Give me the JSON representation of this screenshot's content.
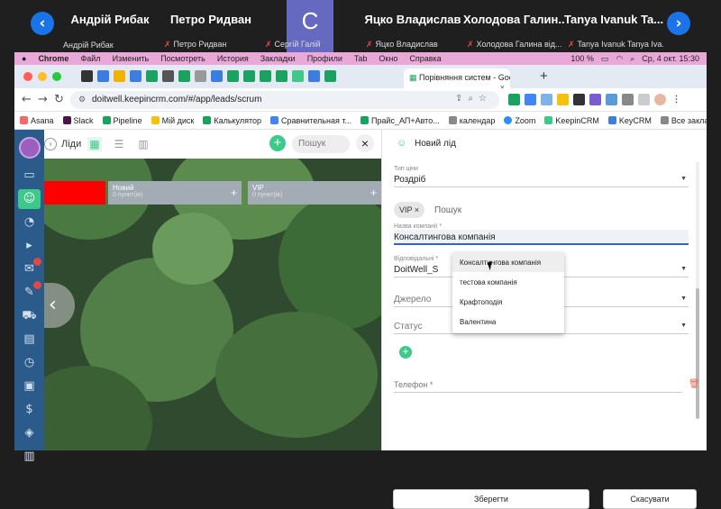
{
  "call": {
    "participants": [
      {
        "big": "Андрій Рибак",
        "small": "Андрій Рибак",
        "muted": false
      },
      {
        "big": "Петро Ридван",
        "small": "Петро Ридван",
        "muted": true
      },
      {
        "big": "C",
        "small": "Сергій Галій",
        "muted": true
      },
      {
        "big": "Яцко Владислав",
        "small": "Яцко Владислав",
        "muted": true
      },
      {
        "big": "Холодова Галин...",
        "small": "Холодова Галина  від...",
        "muted": true
      },
      {
        "big": "Tanya Ivanuk Ta...",
        "small": "Tanya Ivanuk Tanya Iva...",
        "muted": true
      }
    ],
    "prev_icon": "chevron-left-icon",
    "next_icon": "chevron-right-icon"
  },
  "menubar": {
    "items": [
      "Chrome",
      "Файл",
      "Изменить",
      "Посмотреть",
      "История",
      "Закладки",
      "Профили",
      "Tab",
      "Окно",
      "Справка"
    ],
    "battery": "100 %",
    "clock": "Ср, 4 окт.  15:30"
  },
  "browser": {
    "active_tab": "Порівняння систем - Google",
    "url": "doitwell.keepincrm.com/#/app/leads/scrum",
    "bookmarks": [
      "Asana",
      "Slack",
      "Pipeline",
      "Мій диск",
      "Калькулятор",
      "Сравнительная т...",
      "Прайс_АП+Авто...",
      "календар",
      "Zoom",
      "KeepinCRM",
      "KeyCRM"
    ],
    "all_bookmarks": "Все закладки"
  },
  "leads": {
    "title": "Ліди",
    "search_placeholder": "Пошук",
    "columns": [
      {
        "name": "",
        "count": "",
        "color": "#ff0000"
      },
      {
        "name": "Новий",
        "count": "0 пункт(ів)",
        "color": "#a3abb4"
      },
      {
        "name": "VIP",
        "count": "0 пункт(ів)",
        "color": "#a3abb4"
      }
    ]
  },
  "drawer": {
    "title": "Новий лід",
    "price_type_label": "Тип ціни",
    "price_type_value": "Роздріб",
    "tag_chip": "VIP",
    "tag_search": "Пошук",
    "company_label": "Назва компанії *",
    "company_value": "Консалтингова компанія",
    "responsible_label": "Відповідальні *",
    "responsible_value": "DoitWell_S",
    "source_label": "Джерело",
    "status_label": "Статус",
    "phone_label": "Телефон *",
    "dropdown_options": [
      "Консалтингова компанія",
      "тестова компанія",
      "Крафтоподія",
      "Валентина"
    ],
    "save": "Зберегти",
    "cancel": "Скасувати"
  }
}
